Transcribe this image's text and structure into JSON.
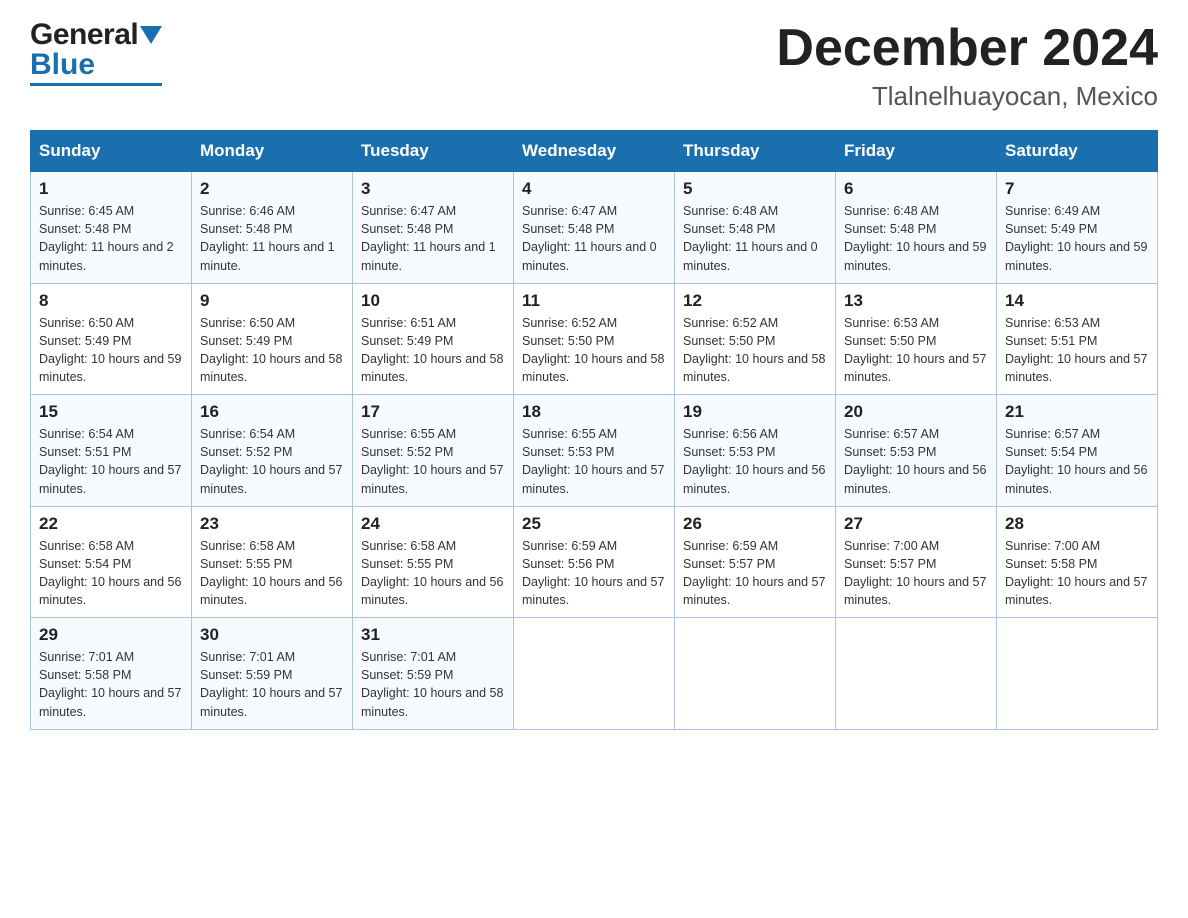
{
  "header": {
    "logo_general": "General",
    "logo_blue": "Blue",
    "month_title": "December 2024",
    "location": "Tlalnelhuayocan, Mexico"
  },
  "days_of_week": [
    "Sunday",
    "Monday",
    "Tuesday",
    "Wednesday",
    "Thursday",
    "Friday",
    "Saturday"
  ],
  "weeks": [
    [
      {
        "day": "1",
        "sunrise": "6:45 AM",
        "sunset": "5:48 PM",
        "daylight": "11 hours and 2 minutes."
      },
      {
        "day": "2",
        "sunrise": "6:46 AM",
        "sunset": "5:48 PM",
        "daylight": "11 hours and 1 minute."
      },
      {
        "day": "3",
        "sunrise": "6:47 AM",
        "sunset": "5:48 PM",
        "daylight": "11 hours and 1 minute."
      },
      {
        "day": "4",
        "sunrise": "6:47 AM",
        "sunset": "5:48 PM",
        "daylight": "11 hours and 0 minutes."
      },
      {
        "day": "5",
        "sunrise": "6:48 AM",
        "sunset": "5:48 PM",
        "daylight": "11 hours and 0 minutes."
      },
      {
        "day": "6",
        "sunrise": "6:48 AM",
        "sunset": "5:48 PM",
        "daylight": "10 hours and 59 minutes."
      },
      {
        "day": "7",
        "sunrise": "6:49 AM",
        "sunset": "5:49 PM",
        "daylight": "10 hours and 59 minutes."
      }
    ],
    [
      {
        "day": "8",
        "sunrise": "6:50 AM",
        "sunset": "5:49 PM",
        "daylight": "10 hours and 59 minutes."
      },
      {
        "day": "9",
        "sunrise": "6:50 AM",
        "sunset": "5:49 PM",
        "daylight": "10 hours and 58 minutes."
      },
      {
        "day": "10",
        "sunrise": "6:51 AM",
        "sunset": "5:49 PM",
        "daylight": "10 hours and 58 minutes."
      },
      {
        "day": "11",
        "sunrise": "6:52 AM",
        "sunset": "5:50 PM",
        "daylight": "10 hours and 58 minutes."
      },
      {
        "day": "12",
        "sunrise": "6:52 AM",
        "sunset": "5:50 PM",
        "daylight": "10 hours and 58 minutes."
      },
      {
        "day": "13",
        "sunrise": "6:53 AM",
        "sunset": "5:50 PM",
        "daylight": "10 hours and 57 minutes."
      },
      {
        "day": "14",
        "sunrise": "6:53 AM",
        "sunset": "5:51 PM",
        "daylight": "10 hours and 57 minutes."
      }
    ],
    [
      {
        "day": "15",
        "sunrise": "6:54 AM",
        "sunset": "5:51 PM",
        "daylight": "10 hours and 57 minutes."
      },
      {
        "day": "16",
        "sunrise": "6:54 AM",
        "sunset": "5:52 PM",
        "daylight": "10 hours and 57 minutes."
      },
      {
        "day": "17",
        "sunrise": "6:55 AM",
        "sunset": "5:52 PM",
        "daylight": "10 hours and 57 minutes."
      },
      {
        "day": "18",
        "sunrise": "6:55 AM",
        "sunset": "5:53 PM",
        "daylight": "10 hours and 57 minutes."
      },
      {
        "day": "19",
        "sunrise": "6:56 AM",
        "sunset": "5:53 PM",
        "daylight": "10 hours and 56 minutes."
      },
      {
        "day": "20",
        "sunrise": "6:57 AM",
        "sunset": "5:53 PM",
        "daylight": "10 hours and 56 minutes."
      },
      {
        "day": "21",
        "sunrise": "6:57 AM",
        "sunset": "5:54 PM",
        "daylight": "10 hours and 56 minutes."
      }
    ],
    [
      {
        "day": "22",
        "sunrise": "6:58 AM",
        "sunset": "5:54 PM",
        "daylight": "10 hours and 56 minutes."
      },
      {
        "day": "23",
        "sunrise": "6:58 AM",
        "sunset": "5:55 PM",
        "daylight": "10 hours and 56 minutes."
      },
      {
        "day": "24",
        "sunrise": "6:58 AM",
        "sunset": "5:55 PM",
        "daylight": "10 hours and 56 minutes."
      },
      {
        "day": "25",
        "sunrise": "6:59 AM",
        "sunset": "5:56 PM",
        "daylight": "10 hours and 57 minutes."
      },
      {
        "day": "26",
        "sunrise": "6:59 AM",
        "sunset": "5:57 PM",
        "daylight": "10 hours and 57 minutes."
      },
      {
        "day": "27",
        "sunrise": "7:00 AM",
        "sunset": "5:57 PM",
        "daylight": "10 hours and 57 minutes."
      },
      {
        "day": "28",
        "sunrise": "7:00 AM",
        "sunset": "5:58 PM",
        "daylight": "10 hours and 57 minutes."
      }
    ],
    [
      {
        "day": "29",
        "sunrise": "7:01 AM",
        "sunset": "5:58 PM",
        "daylight": "10 hours and 57 minutes."
      },
      {
        "day": "30",
        "sunrise": "7:01 AM",
        "sunset": "5:59 PM",
        "daylight": "10 hours and 57 minutes."
      },
      {
        "day": "31",
        "sunrise": "7:01 AM",
        "sunset": "5:59 PM",
        "daylight": "10 hours and 58 minutes."
      },
      null,
      null,
      null,
      null
    ]
  ],
  "labels": {
    "sunrise": "Sunrise:",
    "sunset": "Sunset:",
    "daylight": "Daylight:"
  }
}
